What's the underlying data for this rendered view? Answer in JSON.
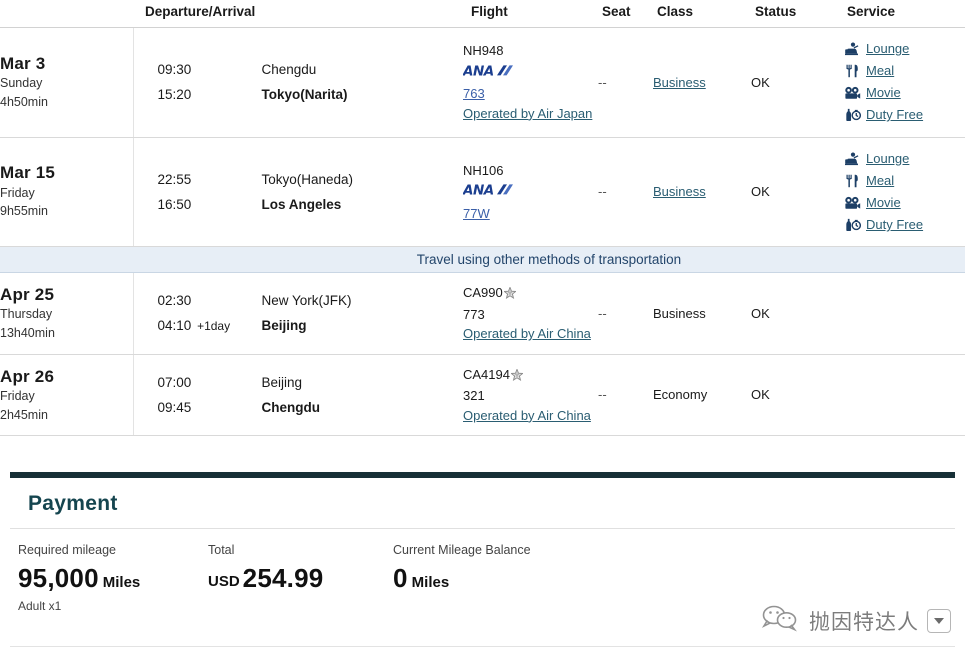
{
  "table": {
    "headers": {
      "date": "",
      "departure_arrival": "Departure/Arrival",
      "flight": "Flight",
      "seat": "Seat",
      "class": "Class",
      "status": "Status",
      "service": "Service"
    },
    "other_transport_note": "Travel using other methods of transportation",
    "rows": [
      {
        "date": "Mar 3",
        "weekday": "Sunday",
        "duration": "4h50min",
        "dep_time": "09:30",
        "dep_city": "Chengdu",
        "arr_time": "15:20",
        "arr_city": "Tokyo(Narita)",
        "arr_offset": "",
        "flight_no": "NH948",
        "carrier_logo": "ana-logo",
        "aircraft": "763",
        "aircraft_is_link": true,
        "operated_by": "Operated by Air Japan",
        "star_alliance": false,
        "seat": "--",
        "class": "Business",
        "class_is_link": true,
        "status": "OK",
        "services": [
          {
            "icon": "lounge-icon",
            "label": "Lounge"
          },
          {
            "icon": "meal-icon",
            "label": "Meal"
          },
          {
            "icon": "movie-icon",
            "label": "Movie"
          },
          {
            "icon": "duty-free-icon",
            "label": "Duty Free"
          }
        ]
      },
      {
        "date": "Mar 15",
        "weekday": "Friday",
        "duration": "9h55min",
        "dep_time": "22:55",
        "dep_city": "Tokyo(Haneda)",
        "arr_time": "16:50",
        "arr_city": "Los Angeles",
        "arr_offset": "",
        "flight_no": "NH106",
        "carrier_logo": "ana-logo",
        "aircraft": "77W",
        "aircraft_is_link": true,
        "operated_by": "",
        "star_alliance": false,
        "seat": "--",
        "class": "Business",
        "class_is_link": true,
        "status": "OK",
        "services": [
          {
            "icon": "lounge-icon",
            "label": "Lounge"
          },
          {
            "icon": "meal-icon",
            "label": "Meal"
          },
          {
            "icon": "movie-icon",
            "label": "Movie"
          },
          {
            "icon": "duty-free-icon",
            "label": "Duty Free"
          }
        ]
      },
      {
        "date": "Apr 25",
        "weekday": "Thursday",
        "duration": "13h40min",
        "dep_time": "02:30",
        "dep_city": "New York(JFK)",
        "arr_time": "04:10",
        "arr_city": "Beijing",
        "arr_offset": "+1day",
        "flight_no": "CA990",
        "carrier_logo": "",
        "aircraft": "773",
        "aircraft_is_link": false,
        "operated_by": "Operated by Air China",
        "star_alliance": true,
        "seat": "--",
        "class": "Business",
        "class_is_link": false,
        "status": "OK",
        "services": []
      },
      {
        "date": "Apr 26",
        "weekday": "Friday",
        "duration": "2h45min",
        "dep_time": "07:00",
        "dep_city": "Beijing",
        "arr_time": "09:45",
        "arr_city": "Chengdu",
        "arr_offset": "",
        "flight_no": "CA4194",
        "carrier_logo": "",
        "aircraft": "321",
        "aircraft_is_link": false,
        "operated_by": "Operated by Air China",
        "star_alliance": true,
        "seat": "--",
        "class": "Economy",
        "class_is_link": false,
        "status": "OK",
        "services": []
      }
    ]
  },
  "payment": {
    "title": "Payment",
    "required_mileage_label": "Required mileage",
    "required_mileage_value": "95,000",
    "required_mileage_unit": "Miles",
    "passengers": "Adult x1",
    "total_label": "Total",
    "total_currency": "USD",
    "total_value": "254.99",
    "current_mileage_label": "Current Mileage Balance",
    "current_mileage_value": "0",
    "current_mileage_unit": "Miles"
  },
  "watermark": {
    "logo": "wechat-icon",
    "text": "抛因特达人",
    "caret": "chevron-down-icon"
  },
  "colors": {
    "link": "#2a5d72",
    "accent_dark": "#173037",
    "payment_title": "#15454f",
    "date_cell_bg": "#f0f0f0",
    "banner_bg": "#e7eef6",
    "ana_blue": "#1b3e8f"
  }
}
